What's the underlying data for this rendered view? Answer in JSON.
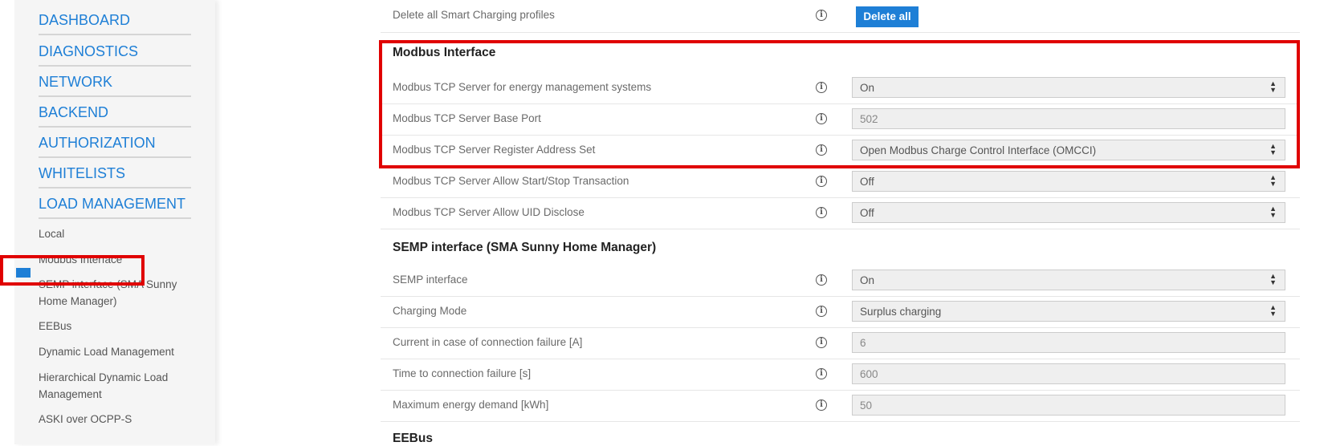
{
  "sidebar": {
    "main_items": [
      "DASHBOARD",
      "DIAGNOSTICS",
      "NETWORK",
      "BACKEND",
      "AUTHORIZATION",
      "WHITELISTS",
      "LOAD MANAGEMENT"
    ],
    "sub_items": [
      "Local",
      "Modbus Interface",
      "SEMP interface (SMA Sunny Home Manager)",
      "EEBus",
      "Dynamic Load Management",
      "Hierarchical Dynamic Load Management",
      "ASKI over OCPP-S"
    ],
    "active_item": "Modbus Interface"
  },
  "top_row": {
    "label": "Delete all Smart Charging profiles",
    "button": "Delete all"
  },
  "modbus": {
    "title": "Modbus Interface",
    "rows": [
      {
        "label": "Modbus TCP Server for energy management systems",
        "value": "On"
      },
      {
        "label": "Modbus TCP Server Base Port",
        "value": "502"
      },
      {
        "label": "Modbus TCP Server Register Address Set",
        "value": "Open Modbus Charge Control Interface (OMCCI)"
      },
      {
        "label": "Modbus TCP Server Allow Start/Stop Transaction",
        "value": "Off"
      },
      {
        "label": "Modbus TCP Server Allow UID Disclose",
        "value": "Off"
      }
    ]
  },
  "semp": {
    "title": "SEMP interface (SMA Sunny Home Manager)",
    "rows": [
      {
        "label": "SEMP interface",
        "value": "On"
      },
      {
        "label": "Charging Mode",
        "value": "Surplus charging"
      },
      {
        "label": "Current in case of connection failure [A]",
        "value": "6"
      },
      {
        "label": "Time to connection failure [s]",
        "value": "600"
      },
      {
        "label": "Maximum energy demand [kWh]",
        "value": "50"
      }
    ]
  },
  "eebus": {
    "title": "EEBus"
  },
  "colors": {
    "accent": "#1e7fd6",
    "highlight": "#e00000"
  },
  "icons": {
    "info": "info-icon",
    "select_arrows": "sort-arrows-icon"
  }
}
